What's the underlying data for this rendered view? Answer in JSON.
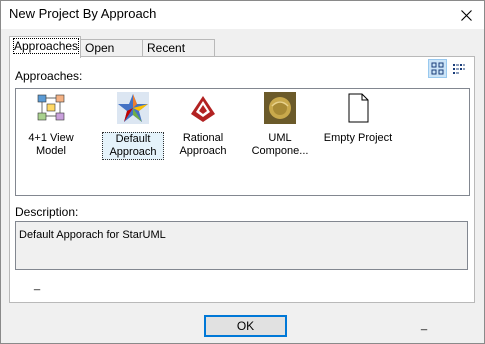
{
  "window": {
    "title": "New Project By Approach"
  },
  "tabs": [
    {
      "label": "Approaches"
    },
    {
      "label": "Open Files"
    },
    {
      "label": "Recent Files"
    }
  ],
  "approaches_label": "Approaches:",
  "items": [
    {
      "label_line1": "4+1 View",
      "label_line2": "Model",
      "icon": "41-view-model-icon",
      "selected": false
    },
    {
      "label_line1": "Default",
      "label_line2": "Approach",
      "icon": "default-approach-icon",
      "selected": true
    },
    {
      "label_line1": "Rational",
      "label_line2": "Approach",
      "icon": "rational-approach-icon",
      "selected": false
    },
    {
      "label_line1": "UML",
      "label_line2": "Compone...",
      "icon": "uml-component-icon",
      "selected": false
    },
    {
      "label_line1": "Empty Project",
      "label_line2": "",
      "icon": "empty-project-icon",
      "selected": false
    }
  ],
  "description_label": "Description:",
  "description_text": "Default Apporach for StarUML",
  "footer": {
    "dash_left": "_",
    "dash_right": "_"
  },
  "ok_label": "OK",
  "colors": {
    "selection": "#e5f3fb",
    "ok_border": "#0078d7"
  }
}
